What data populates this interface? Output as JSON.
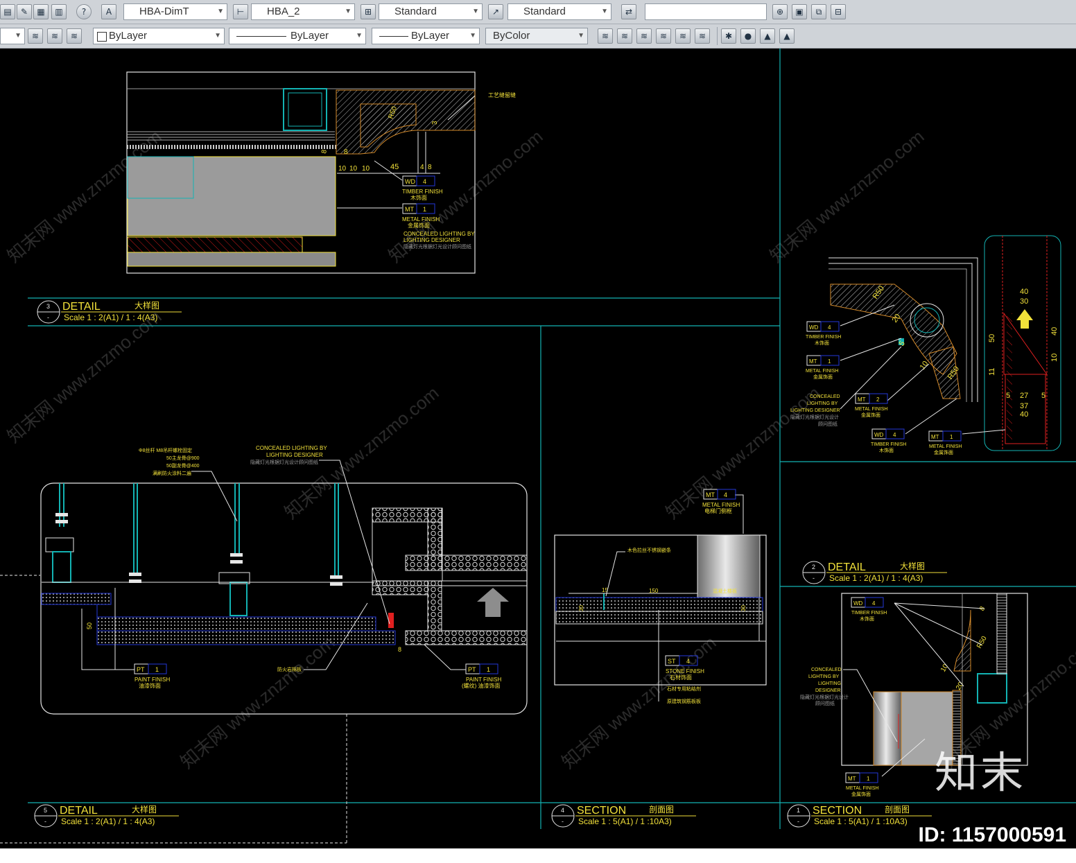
{
  "toolbar_top": {
    "dimstyle_combo": "HBA-DimT",
    "mleader_combo": "HBA_2",
    "table_combo": "Standard",
    "mleaderstyle_combo": "Standard",
    "search_input": ""
  },
  "toolbar_bottom": {
    "color_combo": "ByLayer",
    "linetype_combo": "ByLayer",
    "lineweight_combo": "ByLayer",
    "plotstyle_combo": "ByColor"
  },
  "watermark": {
    "brand": "知末",
    "id_label": "ID: 1157000591",
    "tile_text": "知末网 www.znzmo.com"
  },
  "colors": {
    "canvas": "#000000",
    "frame": "#13b3b3",
    "yellow": "#f2e13a",
    "blue": "#2338d8",
    "white": "#e6e6e6",
    "red": "#e02020",
    "orange": "#d48a2a"
  },
  "drawing": {
    "title3": {
      "num": "3",
      "title": "DETAIL",
      "cn": "大样图",
      "scale": "Scale 1 : 2(A1) / 1 : 4(A3)"
    },
    "title5": {
      "num": "5",
      "title": "DETAIL",
      "cn": "大样图",
      "scale": "Scale 1 : 2(A1) / 1 : 4(A3)"
    },
    "title4": {
      "num": "4",
      "title": "SECTION",
      "cn": "剖面图",
      "scale": "Scale 1 : 5(A1) / 1 :10A3)"
    },
    "title2": {
      "num": "2",
      "title": "DETAIL",
      "cn": "大样图",
      "scale": "Scale 1 : 2(A1) / 1 : 4(A3)"
    },
    "title1": {
      "num": "1",
      "title": "SECTION",
      "cn": "剖面图",
      "scale": "Scale 1 : 5(A1) / 1 :10A3)"
    },
    "d3": {
      "note_top": "工艺缝留缝",
      "dims": [
        "R50",
        "3",
        "8",
        "8",
        "10",
        "10",
        "8",
        "4",
        "10",
        "45",
        "4",
        "8"
      ],
      "tag_wd": {
        "code": "WD",
        "num": "4",
        "en": "TIMBER FINISH",
        "cn": "木饰面"
      },
      "tag_mt": {
        "code": "MT",
        "num": "1",
        "en": "METAL FINISH",
        "cn": "金属饰面"
      },
      "note_light_en1": "CONCEALED LIGHTING BY",
      "note_light_en2": "LIGHTING DESIGNER",
      "note_light_cn": "隐藏灯光根据灯光设计顾问图纸"
    },
    "d5": {
      "note_hanger1": "Φ8丝杆 M8吊杆螺栓固定",
      "note_hanger2": "50主龙骨@900",
      "note_hanger3": "50副龙骨@400",
      "note_hanger4": "满刷防火涂料二遍",
      "note_light_en1": "CONCEALED LIGHTING BY",
      "note_light_en2": "LIGHTING DESIGNER",
      "note_light_cn": "隐藏灯光根据灯光设计顾问图纸",
      "note_fire": "防火岩棉板",
      "dims": [
        "50",
        "8"
      ],
      "tag_pt1": {
        "code": "PT",
        "num": "1",
        "en": "PAINT FINISH",
        "cn": "油漆饰面"
      },
      "tag_pt2": {
        "code": "PT",
        "num": "1",
        "en": "PAINT FINISH",
        "cn": "(螺纹) 油漆饰面"
      }
    },
    "d4": {
      "tag_mt": {
        "code": "MT",
        "num": "4",
        "en": "METAL FINISH",
        "cn": "电梯门侧框"
      },
      "note_strip": "木色拉丝不锈钢嵌条",
      "note_concrete": "混凝土楼板",
      "dims": [
        "15",
        "150",
        "30",
        "30"
      ],
      "tag_st": {
        "code": "ST",
        "num": "4",
        "en": "STONE FINISH",
        "cn": "石材饰面"
      },
      "note_glue": "石材专用粘结剂",
      "note_floor": "原建筑钢筋板板"
    },
    "d2": {
      "tag_wd1": {
        "code": "WD",
        "num": "4",
        "en": "TIMBER FINISH",
        "cn": "木饰面"
      },
      "tag_mt1": {
        "code": "MT",
        "num": "1",
        "en": "METAL FINISH",
        "cn": "金属饰面"
      },
      "note_light_en1": "CONCEALED",
      "note_light_en2": "LIGHTING BY",
      "note_light_en3": "LIGHTING DESIGNER",
      "note_light_cn1": "隐藏灯光根据灯光设计",
      "note_light_cn2": "顾问图纸",
      "tag_mt2": {
        "code": "MT",
        "num": "2",
        "en": "METAL FINISH",
        "cn": "金属饰面"
      },
      "tag_wd2": {
        "code": "WD",
        "num": "4",
        "en": "TIMBER FINISH",
        "cn": "木饰面"
      },
      "tag_mt3": {
        "code": "MT",
        "num": "1",
        "en": "METAL FINISH",
        "cn": "金属饰面"
      },
      "dims": [
        "R50",
        "20",
        "5",
        "10",
        "R50",
        "40",
        "30",
        "50",
        "40",
        "10",
        "5",
        "5",
        "27",
        "37",
        "40",
        "11"
      ]
    },
    "d1": {
      "tag_wd": {
        "code": "WD",
        "num": "4",
        "en": "TIMBER FINISH",
        "cn": "木饰面"
      },
      "note_light_en1": "CONCEALED",
      "note_light_en2": "LIGHTING BY",
      "note_light_en3": "LIGHTING",
      "note_light_en4": "DESIGNER",
      "note_light_cn1": "隐藏灯光根据灯光设计",
      "note_light_cn2": "顾问图纸",
      "dims": [
        "8",
        "R50",
        "10",
        "20"
      ],
      "tag_mt": {
        "code": "MT",
        "num": "1",
        "en": "METAL FINISH",
        "cn": "金属饰面"
      }
    }
  }
}
